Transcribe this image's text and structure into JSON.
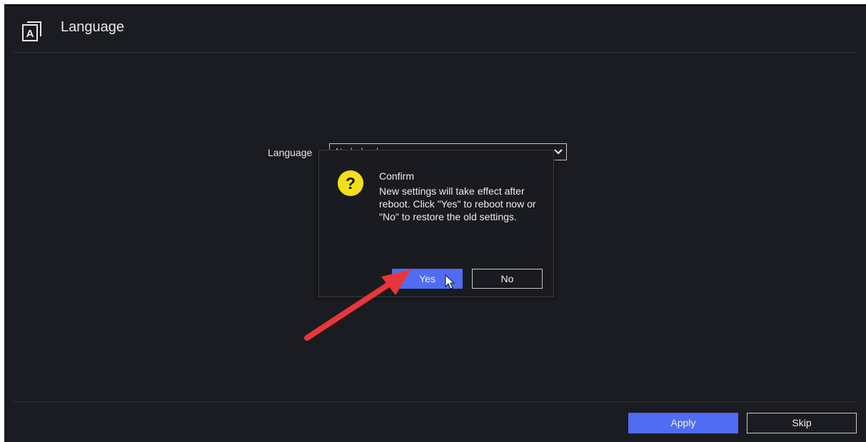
{
  "header": {
    "title": "Language",
    "icon": "language-icon",
    "icon_glyph": "A"
  },
  "form": {
    "language_label": "Language",
    "language_value": "Nederlands"
  },
  "dialog": {
    "title": "Confirm",
    "message": "New settings will take effect after reboot. Click \"Yes\" to reboot now or \"No\" to restore the old settings.",
    "icon": "question-icon",
    "icon_glyph": "?",
    "yes_label": "Yes",
    "no_label": "No"
  },
  "footer": {
    "apply_label": "Apply",
    "skip_label": "Skip"
  },
  "colors": {
    "background": "#1b1c21",
    "accent": "#4f6cf3",
    "question": "#f2df1a",
    "annotation_arrow": "#e8363b"
  }
}
